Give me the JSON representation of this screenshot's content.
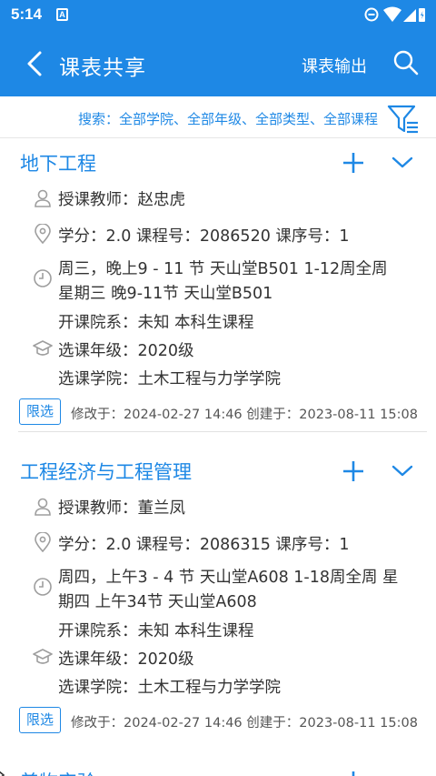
{
  "status_bar": {
    "time": "5:14",
    "notification_letter": "A"
  },
  "app_bar": {
    "title": "课表共享",
    "export_label": "课表输出"
  },
  "filter": {
    "text": "搜索：全部学院、全部年级、全部类型、全部课程"
  },
  "courses": [
    {
      "name": "地下工程",
      "teacher": "授课教师：赵忠虎",
      "credit": "学分：2.0 课程号：2086520 课序号：1",
      "time_line1": "周三，晚上9 - 11 节 天山堂B501 1-12周全周",
      "time_line2": "星期三 晚9-11节 天山堂B501",
      "department": "开课院系：未知 本科生课程",
      "grade": "选课年级：2020级",
      "college": "选课学院：土木工程与力学学院",
      "badge": "限选",
      "meta": "修改于：2024-02-27 14:46 创建于：2023-08-11 15:08"
    },
    {
      "name": "工程经济与工程管理",
      "teacher": "授课教师：董兰凤",
      "credit": "学分：2.0 课程号：2086315 课序号：1",
      "time_line1": "周四，上午3 - 4 节 天山堂A608 1-18周全周 星",
      "time_line2": "期四 上午34节 天山堂A608",
      "department": "开课院系：未知 本科生课程",
      "grade": "选课年级：2020级",
      "college": "选课学院：土木工程与力学学院",
      "badge": "限选",
      "meta": "修改于：2024-02-27 14:46 创建于：2023-08-11 15:08"
    },
    {
      "name": "普物实验"
    }
  ],
  "colors": {
    "primary": "#1e88e5",
    "text": "#333333",
    "icon_gray": "#9e9e9e"
  }
}
